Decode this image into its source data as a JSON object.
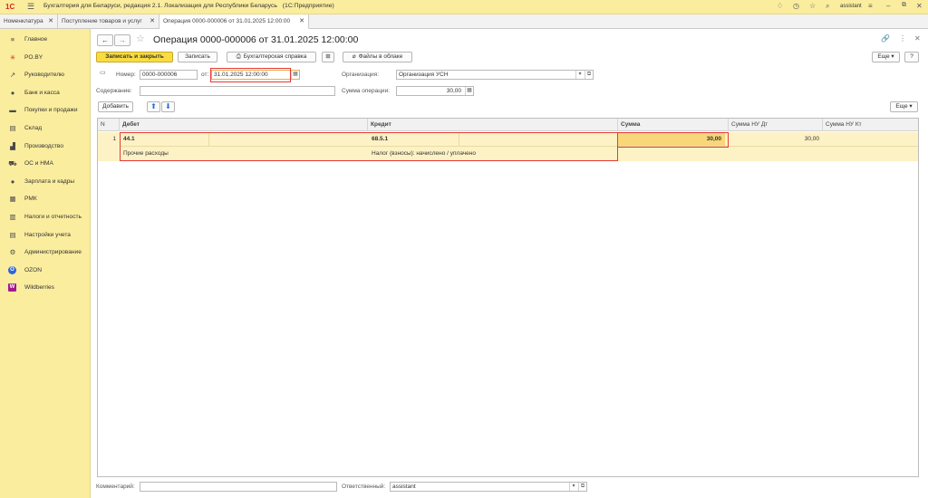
{
  "app": {
    "title": "Бухгалтерия для Беларуси, редакция 2.1. Локализация для Республики Беларусь",
    "subtitle": "(1С:Предприятие)",
    "user": "assistant"
  },
  "tabs": [
    {
      "label": "Номенклатура"
    },
    {
      "label": "Поступление товаров и услуг"
    },
    {
      "label": "Операция 0000-000006 от 31.01.2025 12:00:00"
    }
  ],
  "sidebar": {
    "items": [
      {
        "label": "Главное",
        "icon": "≡"
      },
      {
        "label": "PO.BY",
        "icon": "✳"
      },
      {
        "label": "Руководителю",
        "icon": "↗"
      },
      {
        "label": "Банк и касса",
        "icon": "●"
      },
      {
        "label": "Покупки и продажи",
        "icon": "▬"
      },
      {
        "label": "Склад",
        "icon": "▤"
      },
      {
        "label": "Производство",
        "icon": "▟"
      },
      {
        "label": "ОС и НМА",
        "icon": "⛟"
      },
      {
        "label": "Зарплата и кадры",
        "icon": "●"
      },
      {
        "label": "РМК",
        "icon": "▦"
      },
      {
        "label": "Налоги и отчетность",
        "icon": "▥"
      },
      {
        "label": "Настройки учета",
        "icon": "▤"
      },
      {
        "label": "Администрирование",
        "icon": "⚙"
      },
      {
        "label": "OZON",
        "icon": "O"
      },
      {
        "label": "Wildberries",
        "icon": "W"
      }
    ]
  },
  "document": {
    "title": "Операция 0000-000006 от 31.01.2025 12:00:00",
    "toolbar": {
      "save_close": "Записать и закрыть",
      "save": "Записать",
      "reference": "Бухгалтерская справка",
      "cloud_files": "Файлы в облаке",
      "more": "Еще"
    },
    "fields": {
      "number_label": "Номер:",
      "number_value": "0000-000006",
      "date_label": "от:",
      "date_value": "31.01.2025 12:00:00",
      "org_label": "Организация:",
      "org_value": "Организация УСН",
      "content_label": "Содержание:",
      "content_value": "",
      "sum_label": "Сумма операции:",
      "sum_value": "30,00",
      "comment_label": "Комментарий:",
      "comment_value": "",
      "responsible_label": "Ответственный:",
      "responsible_value": "assistant"
    },
    "table_toolbar": {
      "add": "Добавить",
      "more": "Еще"
    },
    "table": {
      "headers": [
        "N",
        "Дебет",
        "Кредит",
        "Сумма",
        "Сумма НУ Дт",
        "Сумма НУ Кт"
      ],
      "rows": [
        {
          "n": "1",
          "debit": "44.1",
          "debit_sub": "Прочие расходы",
          "credit": "68.5.1",
          "credit_sub": "Налог (взносы): начислено / уплачено",
          "sum": "30,00",
          "sum_nu_dt": "30,00",
          "sum_nu_kt": ""
        }
      ]
    }
  },
  "colors": {
    "sidebar_bg": "#fbed9e",
    "primary_button": "#f9dc3f",
    "row_highlight": "#fdf2c5",
    "highlight_box": "#e53935"
  }
}
